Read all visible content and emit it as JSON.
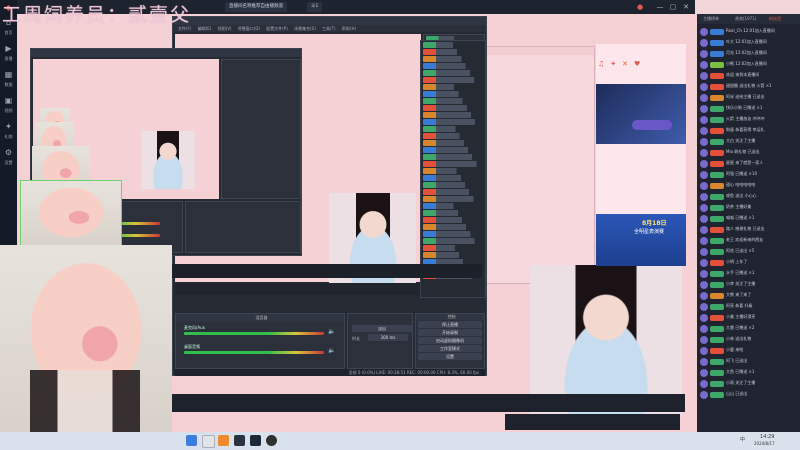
{
  "watermark": {
    "text": "工周饲养员：贰壹父"
  },
  "titlebar": {
    "tabs": [
      "直播间名称推荐自由播频道",
      "斗1"
    ],
    "controls": {
      "minimize": "—",
      "maximize": "▢",
      "close": "✕"
    }
  },
  "leftrail": {
    "items": [
      {
        "icon": "home-icon",
        "label": "首页"
      },
      {
        "icon": "live-icon",
        "label": "直播"
      },
      {
        "icon": "chart-icon",
        "label": "数据"
      },
      {
        "icon": "video-icon",
        "label": "视频"
      },
      {
        "icon": "gift-icon",
        "label": "礼物"
      },
      {
        "icon": "settings-icon",
        "label": "设置"
      }
    ]
  },
  "obs": {
    "menu": [
      "文件(F)",
      "编辑(E)",
      "视图(V)",
      "停靠窗口(D)",
      "配置文件(P)",
      "场景集合(S)",
      "工具(T)",
      "帮助(H)"
    ],
    "docks": {
      "audio_mixer": "混音器",
      "controls": "控制"
    },
    "mixer": {
      "track1": "麦克风/Aux",
      "track2": "桌面音频"
    },
    "transition": {
      "fade_label": "淡出",
      "duration_label": "时长",
      "duration_value": "300 ms"
    },
    "buttons": [
      "停止直播",
      "开始录制",
      "启动虚拟摄像机",
      "工作室模式",
      "设置",
      "退出"
    ],
    "status": "丢帧 0 (0.0%)  LIVE: 00:38:51  REC: 00:00:00  CPU: 8.3%, 60.00 fps"
  },
  "web": {
    "promo_tag": "8月18日",
    "promo_text": "全明星表演赛"
  },
  "sidebar": {
    "tabs": [
      "主播榜单",
      "贵宾(1971)",
      "粉丝团"
    ],
    "rows": [
      {
        "name": "Real_Ch",
        "text": "12:01加入直播间",
        "badge": "#3a7bd5"
      },
      {
        "name": "叶大",
        "text": "12:01加入直播间",
        "badge": "#3a7bd5"
      },
      {
        "name": "月光",
        "text": "12:02加入直播间",
        "badge": "#3a7bd5"
      },
      {
        "name": "小熊",
        "text": "12:02加入直播间",
        "badge": "#7ac043"
      },
      {
        "name": "欢迎",
        "text": "来到本直播间",
        "badge": "#e5503b"
      },
      {
        "name": "甜甜圈",
        "text": "送出礼物 火箭 ×1",
        "badge": "#e5503b"
      },
      {
        "name": "阿米",
        "text": "送给主播 已送出",
        "badge": "#d9862f"
      },
      {
        "name": "快乐小狗",
        "text": "已赠送 ×1",
        "badge": "#3ea86a"
      },
      {
        "name": "火箭",
        "text": "主播加油 冲冲冲",
        "badge": "#3ea86a"
      },
      {
        "name": "狗蛋",
        "text": "恭喜获得 幸运礼",
        "badge": "#e5503b"
      },
      {
        "name": "大白",
        "text": "关注了主播",
        "badge": "#3ea86a"
      },
      {
        "name": "Mio",
        "text": "刷礼物 已送出",
        "badge": "#e5503b"
      },
      {
        "name": "星星",
        "text": "来了就是一家人",
        "badge": "#e5503b"
      },
      {
        "name": "阿强",
        "text": "已赠送 ×10",
        "badge": "#3ea86a"
      },
      {
        "name": "甜心",
        "text": "哈哈哈哈哈",
        "badge": "#d9862f"
      },
      {
        "name": "咸鱼",
        "text": "送出 小心心",
        "badge": "#3ea86a"
      },
      {
        "name": "奶茶",
        "text": "主播好美",
        "badge": "#3ea86a"
      },
      {
        "name": "喵喵",
        "text": "已赠送 ×1",
        "badge": "#3ea86a"
      },
      {
        "name": "路人",
        "text": "感谢礼物 已送出",
        "badge": "#e5503b"
      },
      {
        "name": "老王",
        "text": "欢迎新来的朋友",
        "badge": "#3ea86a"
      },
      {
        "name": "阿花",
        "text": "已送出 ×5",
        "badge": "#3ea86a"
      },
      {
        "name": "小明",
        "text": "上车了",
        "badge": "#e5503b"
      },
      {
        "name": "水手",
        "text": "已赠送 ×1",
        "badge": "#3ea86a"
      },
      {
        "name": "小李",
        "text": "关注了主播",
        "badge": "#3ea86a"
      },
      {
        "name": "大熊",
        "text": "来了来了",
        "badge": "#d9862f"
      },
      {
        "name": "阿亮",
        "text": "恭喜 升级",
        "badge": "#3ea86a"
      },
      {
        "name": "小美",
        "text": "主播好漂亮",
        "badge": "#e5503b"
      },
      {
        "name": "大雷",
        "text": "已赠送 ×2",
        "badge": "#3ea86a"
      },
      {
        "name": "小林",
        "text": "送出礼物",
        "badge": "#3ea86a"
      },
      {
        "name": "小鹿",
        "text": "来啦",
        "badge": "#e5503b"
      },
      {
        "name": "阿飞",
        "text": "已送出",
        "badge": "#3ea86a"
      },
      {
        "name": "大鱼",
        "text": "已赠送 ×1",
        "badge": "#3ea86a"
      },
      {
        "name": "小雨",
        "text": "关注了主播",
        "badge": "#3ea86a"
      },
      {
        "name": "山山",
        "text": "已送出",
        "badge": "#3ea86a"
      }
    ]
  },
  "taskbar": {
    "time": "14:29",
    "date": "2024/8/17",
    "lang": "中"
  }
}
